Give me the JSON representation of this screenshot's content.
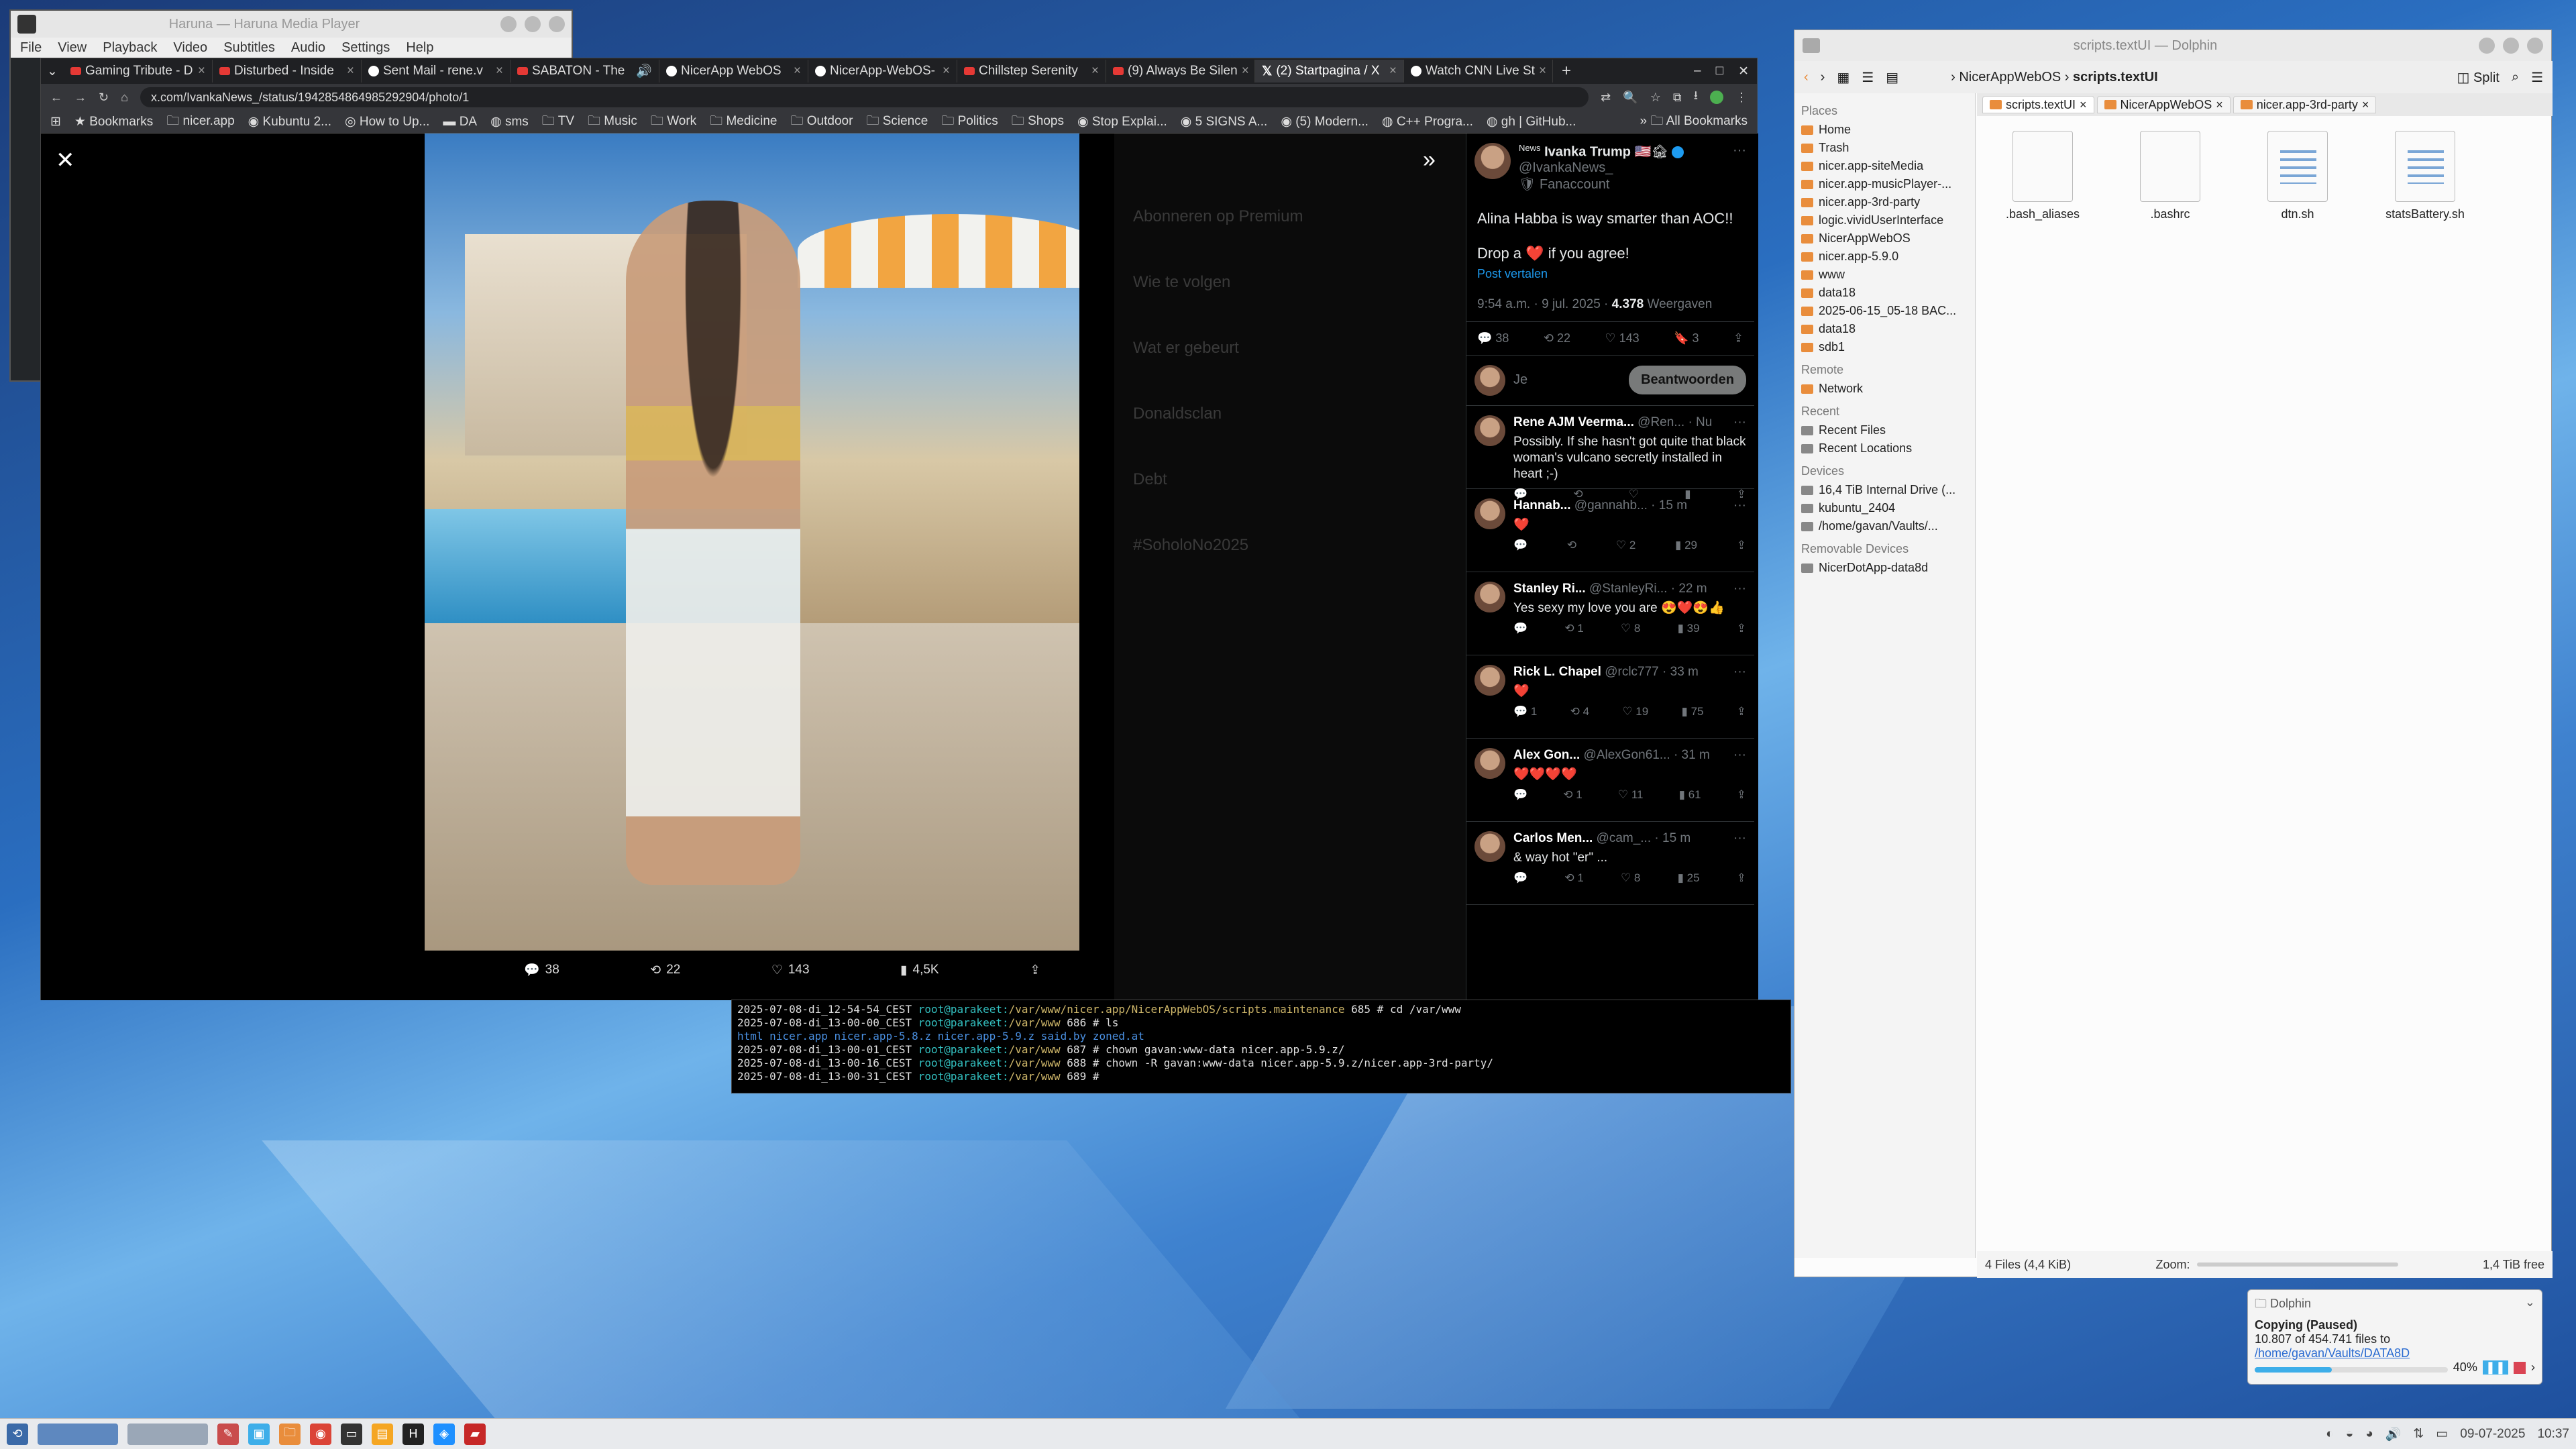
{
  "haruna": {
    "title": "Haruna — Haruna Media Player",
    "menu": [
      "File",
      "View",
      "Playback",
      "Video",
      "Subtitles",
      "Audio",
      "Settings",
      "Help"
    ]
  },
  "browser": {
    "tabs": [
      "Gaming Tribute - D",
      "Disturbed - Inside",
      "Sent Mail - rene.v",
      "SABATON - The",
      "NicerApp WebOS",
      "NicerApp-WebOS-",
      "Chillstep Serenity",
      "(9) Always Be Silen",
      "(2) Startpagina / X",
      "Watch CNN Live St"
    ],
    "active_tab": 8,
    "url": "x.com/IvankaNews_/status/1942854864985292904/photo/1",
    "bookmarks": [
      "Bookmarks",
      "nicer.app",
      "Kubuntu 2...",
      "How to Up...",
      "DA",
      "sms",
      "TV",
      "Music",
      "Work",
      "Medicine",
      "Outdoor",
      "Science",
      "Politics",
      "Shops",
      "Stop Explai...",
      "5 SIGNS A...",
      "(5) Modern...",
      "C++ Progra...",
      "gh | GitHub..."
    ],
    "all_bookmarks": "All Bookmarks"
  },
  "feed_bg": {
    "items": [
      "Abonneren op Premium",
      "Wie te volgen",
      "Wat er gebeurt",
      "Donaldsclan",
      "Debt",
      "#SoholoNo2025"
    ]
  },
  "photo": {
    "actions": {
      "replies": "38",
      "reposts": "22",
      "likes": "143",
      "views": "4,5K"
    }
  },
  "tweet": {
    "name": "Ivanka Trump",
    "badge": "News",
    "flag": "🇺🇸🏚",
    "handle": "@IvankaNews_",
    "fan": "Fanaccount",
    "text1": "Alina Habba is way smarter than AOC!!",
    "text2": "Drop a",
    "text3": "if you agree!",
    "translate": "Post vertalen",
    "time": "9:54 a.m. · 9 jul. 2025 ·",
    "views": "4.378",
    "views_label": "Weergaven",
    "stats": {
      "replies": "38",
      "reposts": "22",
      "likes": "143",
      "bookmarks": "3"
    },
    "reply_placeholder": "Je",
    "reply_button": "Beantwoorden"
  },
  "replies": [
    {
      "name": "Rene AJM Veerma...",
      "handle": "@Ren...",
      "time": "· Nu",
      "text": "Possibly. If she hasn't got quite that black woman's vulcano secretly installed in heart ;-)",
      "r": "",
      "rt": "",
      "l": "",
      "v": ""
    },
    {
      "name": "Hannab...",
      "handle": "@gannahb...",
      "time": "· 15 m",
      "text": "❤️",
      "r": "",
      "rt": "",
      "l": "2",
      "v": "29"
    },
    {
      "name": "Stanley Ri...",
      "handle": "@StanleyRi...",
      "time": "· 22 m",
      "text": "Yes sexy my love you are 😍❤️😍👍",
      "r": "",
      "rt": "1",
      "l": "8",
      "v": "39"
    },
    {
      "name": "Rick L. Chapel",
      "handle": "@rclc777",
      "time": "· 33 m",
      "text": "❤️",
      "r": "1",
      "rt": "4",
      "l": "19",
      "v": "75"
    },
    {
      "name": "Alex Gon...",
      "handle": "@AlexGon61...",
      "time": "· 31 m",
      "text": "❤️❤️❤️❤️",
      "r": "",
      "rt": "1",
      "l": "11",
      "v": "61"
    },
    {
      "name": "Carlos Men...",
      "handle": "@cam_...",
      "time": "· 15 m",
      "text": "& way hot \"er\" ...",
      "r": "",
      "rt": "1",
      "l": "8",
      "v": "25"
    }
  ],
  "terminal": {
    "lines": [
      {
        "ts": "2025-07-08-di_12-54-54_CEST",
        "user": "root@parakeet:",
        "path": "/var/www/nicer.app/NicerAppWebOS/scripts.maintenance",
        "cmd": "685 # cd /var/www"
      },
      {
        "ts": "2025-07-08-di_13-00-00_CEST",
        "user": "root@parakeet:",
        "path": "/var/www",
        "cmd": "686 # ls"
      },
      {
        "ts": "html  nicer.app  nicer.app-5.8.z  nicer.app-5.9.z  said.by  zoned.at",
        "user": "",
        "path": "",
        "cmd": ""
      },
      {
        "ts": "2025-07-08-di_13-00-01_CEST",
        "user": "root@parakeet:",
        "path": "/var/www",
        "cmd": "687 # chown gavan:www-data nicer.app-5.9.z/"
      },
      {
        "ts": "2025-07-08-di_13-00-16_CEST",
        "user": "root@parakeet:",
        "path": "/var/www",
        "cmd": "688 # chown -R gavan:www-data nicer.app-5.9.z/nicer.app-3rd-party/"
      },
      {
        "ts": "2025-07-08-di_13-00-31_CEST",
        "user": "root@parakeet:",
        "path": "/var/www",
        "cmd": "689 # "
      }
    ]
  },
  "dolphin": {
    "title": "scripts.textUI — Dolphin",
    "breadcrumb": [
      "NicerAppWebOS",
      "scripts.textUI"
    ],
    "split": "Split",
    "tabs": [
      "scripts.textUI",
      "NicerAppWebOS",
      "nicer.app-3rd-party"
    ],
    "places_header": "Places",
    "places": [
      "Home",
      "Trash",
      "nicer.app-siteMedia",
      "nicer.app-musicPlayer-...",
      "nicer.app-3rd-party",
      "logic.vividUserInterface",
      "NicerAppWebOS",
      "nicer.app-5.9.0",
      "www",
      "data18",
      "2025-06-15_05-18 BAC...",
      "data18",
      "sdb1"
    ],
    "remote_header": "Remote",
    "remote": [
      "Network"
    ],
    "recent_header": "Recent",
    "recent": [
      "Recent Files",
      "Recent Locations"
    ],
    "devices_header": "Devices",
    "devices": [
      "16,4 TiB Internal Drive (...",
      "kubuntu_2404",
      "/home/gavan/Vaults/..."
    ],
    "removable_header": "Removable Devices",
    "removable": [
      "NicerDotApp-data8d"
    ],
    "files": [
      ".bash_aliases",
      ".bashrc",
      "dtn.sh",
      "statsBattery.sh"
    ],
    "status": "4 Files (4,4 KiB)",
    "zoom": "Zoom:",
    "free": "1,4 TiB free"
  },
  "copy": {
    "app": "Dolphin",
    "title": "Copying (Paused)",
    "text": "10.807 of 454.741 files to",
    "dest": "/home/gavan/Vaults/DATA8D",
    "percent": "40%",
    "progress": 0.4
  },
  "taskbar": {
    "date": "09-07-2025",
    "time": "10:37"
  }
}
